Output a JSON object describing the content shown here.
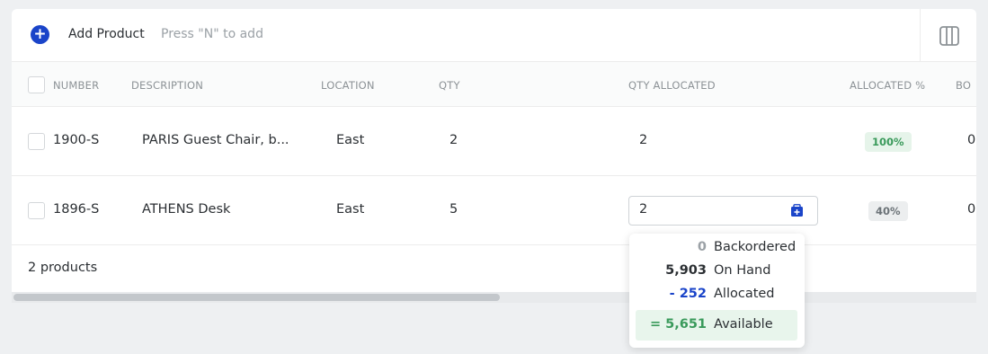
{
  "toolbar": {
    "add_label": "Add Product",
    "add_hint": "Press \"N\" to add",
    "add_icon": "plus-icon",
    "columns_icon": "columns-icon"
  },
  "columns": {
    "number": "NUMBER",
    "description": "DESCRIPTION",
    "location": "LOCATION",
    "qty": "QTY",
    "qty_allocated": "QTY ALLOCATED",
    "allocated_pct": "ALLOCATED %",
    "bo": "BO"
  },
  "rows": [
    {
      "number": "1900-S",
      "description": "PARIS Guest Chair, b...",
      "location": "East",
      "qty": "2",
      "qty_allocated": "2",
      "allocated_pct": "100%",
      "bo": "0"
    },
    {
      "number": "1896-S",
      "description": "ATHENS Desk",
      "location": "East",
      "qty": "5",
      "qty_allocated": "2",
      "allocated_pct": "40%",
      "bo": "0"
    }
  ],
  "footer": {
    "count_text": "2 products"
  },
  "popover": {
    "backordered": {
      "value": "0",
      "label": "Backordered"
    },
    "on_hand": {
      "value": "5,903",
      "label": "On Hand"
    },
    "allocated": {
      "value": "- 252",
      "label": "Allocated"
    },
    "available": {
      "value": "= 5,651",
      "label": "Available"
    }
  },
  "colors": {
    "accent": "#1a44c9",
    "success": "#3a9a5b",
    "muted": "#9ba1a6"
  }
}
